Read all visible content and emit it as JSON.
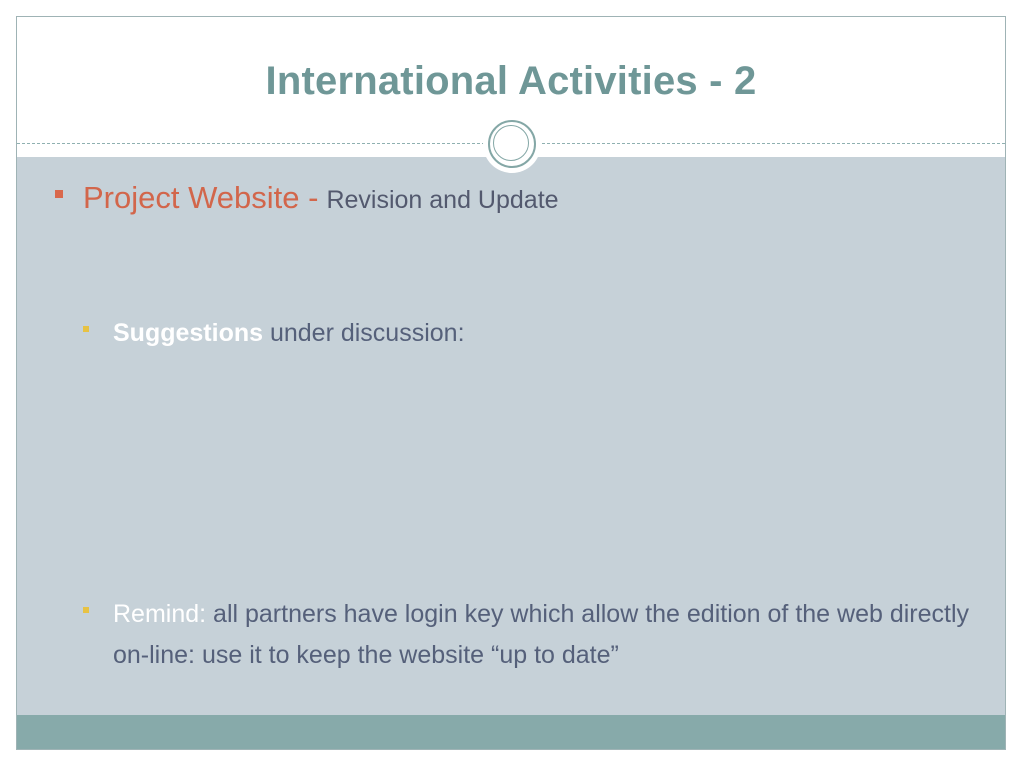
{
  "slide": {
    "title": "International Activities - 2",
    "bullet_1": {
      "main": "Project Website -",
      "sub": "Revision and Update"
    },
    "sub_bullet_1": {
      "highlight": "Suggestions",
      "text": " under discussion:"
    },
    "sub_bullet_2": {
      "highlight": "Remind:",
      "text": " all partners have login key which allow the edition of the web directly on-line: use it to keep the website “up to date”"
    }
  },
  "colors": {
    "title": "#6f9797",
    "accent_red": "#d2664b",
    "content_bg": "#c6d1d8",
    "footer_bar": "#87aaaa",
    "sub_bullet_marker": "#e7c243",
    "body_text": "#55607a"
  }
}
